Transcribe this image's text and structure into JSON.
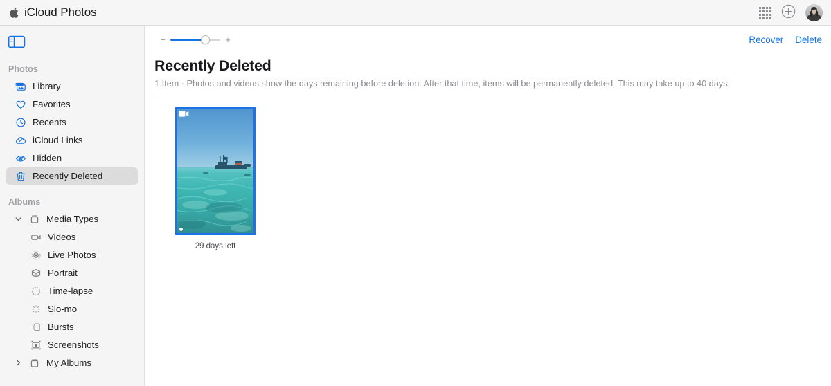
{
  "window": {
    "brand_prefix": "iCloud",
    "brand_app": "Photos",
    "apple_logo_icon": "apple-logo-icon",
    "apps_grid_icon": "apps-grid-icon",
    "add_icon": "plus-circle-icon",
    "avatar_icon": "user-avatar"
  },
  "sidebar": {
    "toggle_icon": "sidebar-toggle-icon",
    "sections": [
      {
        "title": "Photos",
        "items": [
          {
            "label": "Library",
            "icon": "photos-library-icon",
            "selected": false
          },
          {
            "label": "Favorites",
            "icon": "heart-icon",
            "selected": false
          },
          {
            "label": "Recents",
            "icon": "clock-icon",
            "selected": false
          },
          {
            "label": "iCloud Links",
            "icon": "cloud-link-icon",
            "selected": false
          },
          {
            "label": "Hidden",
            "icon": "eye-slash-icon",
            "selected": false
          },
          {
            "label": "Recently Deleted",
            "icon": "trash-icon",
            "selected": true
          }
        ]
      },
      {
        "title": "Albums",
        "items": [
          {
            "label": "Media Types",
            "icon": "album-box-icon",
            "chevron": "chevron-down-icon",
            "expanded": true
          },
          {
            "label": "Videos",
            "icon": "video-camera-icon",
            "sub": true
          },
          {
            "label": "Live Photos",
            "icon": "live-photo-icon",
            "sub": true
          },
          {
            "label": "Portrait",
            "icon": "portrait-cube-icon",
            "sub": true
          },
          {
            "label": "Time-lapse",
            "icon": "timelapse-icon",
            "sub": true
          },
          {
            "label": "Slo-mo",
            "icon": "slomo-icon",
            "sub": true
          },
          {
            "label": "Bursts",
            "icon": "bursts-icon",
            "sub": true
          },
          {
            "label": "Screenshots",
            "icon": "screenshot-icon",
            "sub": true
          },
          {
            "label": "My Albums",
            "icon": "album-box-icon",
            "chevron": "chevron-right-icon",
            "expanded": false
          }
        ]
      }
    ]
  },
  "toolbar": {
    "zoom_out_label": "−",
    "zoom_in_label": "+",
    "zoom_value": 70,
    "recover_label": "Recover",
    "delete_label": "Delete",
    "annotation_color": "#f42a13",
    "annotation_target": "Recover"
  },
  "main": {
    "title": "Recently Deleted",
    "subtitle": "1 Item  ·  Photos and videos show the days remaining before deletion. After that time, items will be permanently deleted. This may take up to 40 days.",
    "item_count_text": "1 Item",
    "items": [
      {
        "caption": "29 days left",
        "media_type": "video",
        "selected": true,
        "badge_icon": "video-camera-badge-icon",
        "alt": "Ocean scene with turquoise water, boat on the horizon under blue sky"
      }
    ]
  },
  "colors": {
    "accent": "#1573e6",
    "selection_border": "#1a73e8",
    "sidebar_bg": "#f5f5f5",
    "topbar_bg": "#f6f6f6",
    "annotation_red": "#f42a13"
  }
}
